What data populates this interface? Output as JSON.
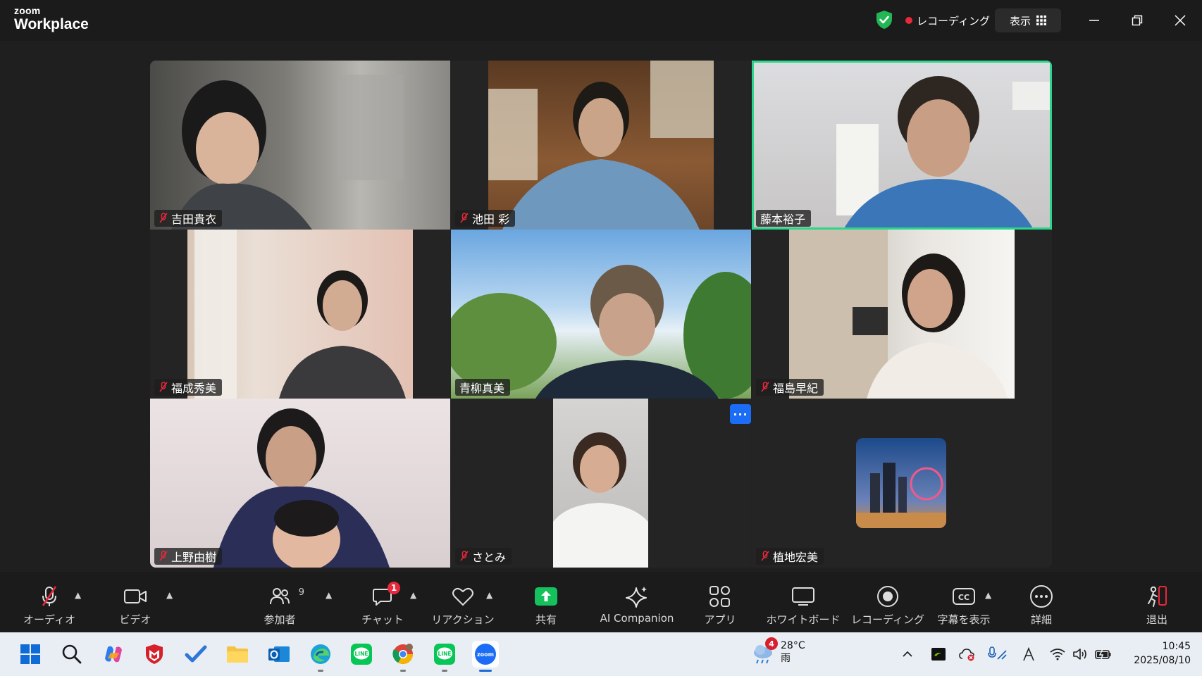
{
  "app": {
    "logo_small": "zoom",
    "logo_big": "Workplace"
  },
  "header": {
    "recording_label": "レコーディング",
    "view_label": "表示"
  },
  "participants": [
    {
      "name": "吉田貴衣",
      "muted": true
    },
    {
      "name": "池田 彩",
      "muted": true
    },
    {
      "name": "藤本裕子",
      "muted": false,
      "speaking": true
    },
    {
      "name": "福成秀美",
      "muted": true
    },
    {
      "name": "青柳真美",
      "muted": false
    },
    {
      "name": "福島早紀",
      "muted": true
    },
    {
      "name": "上野由樹",
      "muted": true
    },
    {
      "name": "さとみ",
      "muted": true
    },
    {
      "name": "植地宏美",
      "muted": true,
      "video_off": true
    }
  ],
  "tile_more_label": "···",
  "toolbar": {
    "audio": "オーディオ",
    "video": "ビデオ",
    "participants": "参加者",
    "participants_count": "9",
    "chat": "チャット",
    "chat_badge": "1",
    "reactions": "リアクション",
    "share": "共有",
    "ai_companion": "AI Companion",
    "apps": "アプリ",
    "whiteboard": "ホワイトボード",
    "recording": "レコーディング",
    "captions": "字幕を表示",
    "more": "詳細",
    "leave": "退出"
  },
  "taskbar": {
    "weather_temp": "28°C",
    "weather_cond": "雨",
    "weather_badge": "4",
    "time": "10:45",
    "date": "2025/08/10",
    "zoom_label": "zoom"
  },
  "colors": {
    "active_speaker": "#2bd68a",
    "record_red": "#e8283b",
    "share_green": "#14c15c",
    "zoom_blue": "#1b6df5"
  }
}
